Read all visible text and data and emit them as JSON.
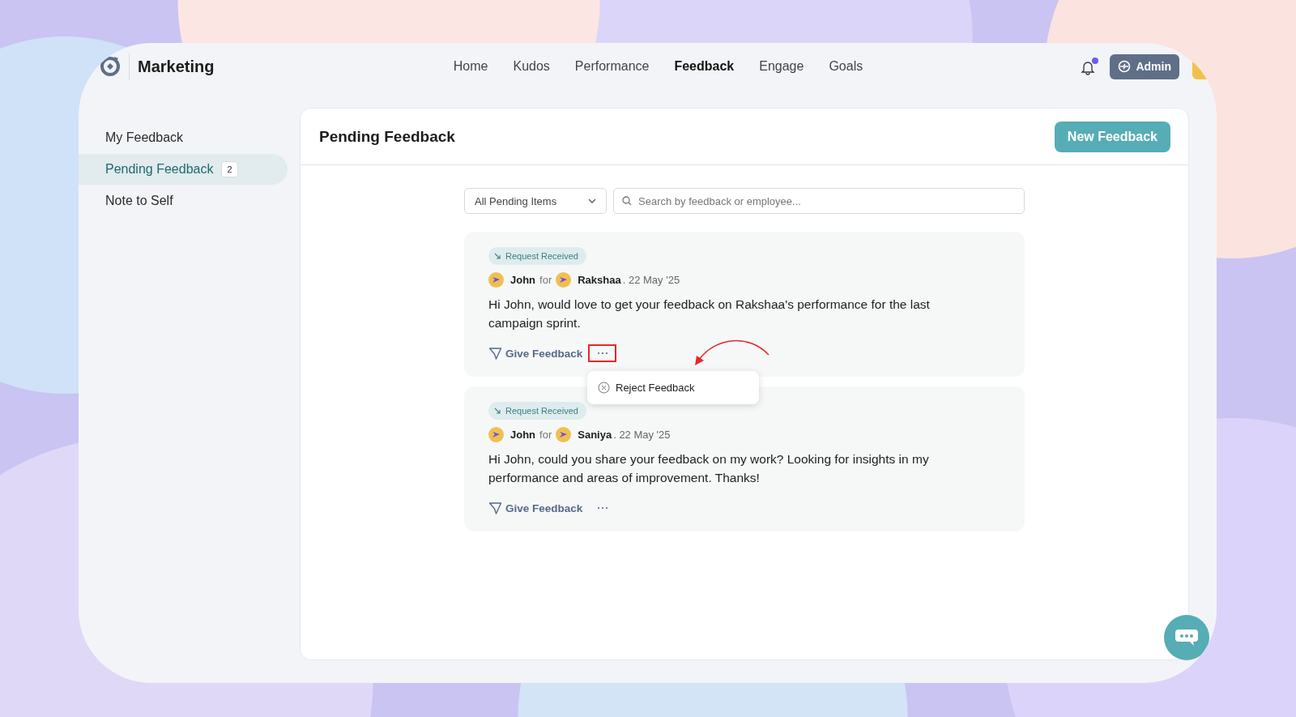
{
  "header": {
    "brand": "Marketing",
    "nav": [
      {
        "label": "Home",
        "selected": false
      },
      {
        "label": "Kudos",
        "selected": false
      },
      {
        "label": "Performance",
        "selected": false
      },
      {
        "label": "Feedback",
        "selected": true
      },
      {
        "label": "Engage",
        "selected": false
      },
      {
        "label": "Goals",
        "selected": false
      }
    ],
    "notification_unread": true,
    "role_button": "Admin"
  },
  "sidebar": {
    "items": [
      {
        "label": "My Feedback",
        "selected": false
      },
      {
        "label": "Pending Feedback",
        "selected": true,
        "count": "2"
      },
      {
        "label": "Note to Self",
        "selected": false
      }
    ]
  },
  "panel": {
    "title": "Pending Feedback",
    "new_button": "New Feedback",
    "filter": {
      "value": "All Pending Items"
    },
    "search": {
      "placeholder": "Search by feedback or employee..."
    },
    "cards": [
      {
        "tag": "Request Received",
        "from": "John",
        "for_word": "for",
        "to": "Rakshaa",
        "date": ". 22 May '25",
        "message": "Hi John, would love to get your feedback on Rakshaa's performance for the last campaign sprint.",
        "action": "Give Feedback",
        "more_highlighted": true,
        "menu_open": true,
        "menu_items": [
          {
            "label": "Reject Feedback"
          }
        ]
      },
      {
        "tag": "Request Received",
        "from": "John",
        "for_word": "for",
        "to": "Saniya",
        "date": ". 22 May '25",
        "message": "Hi John, could you share your feedback on my work? Looking for insights in my performance and areas of improvement. Thanks!",
        "action": "Give Feedback",
        "more_highlighted": false,
        "menu_open": false
      }
    ]
  }
}
